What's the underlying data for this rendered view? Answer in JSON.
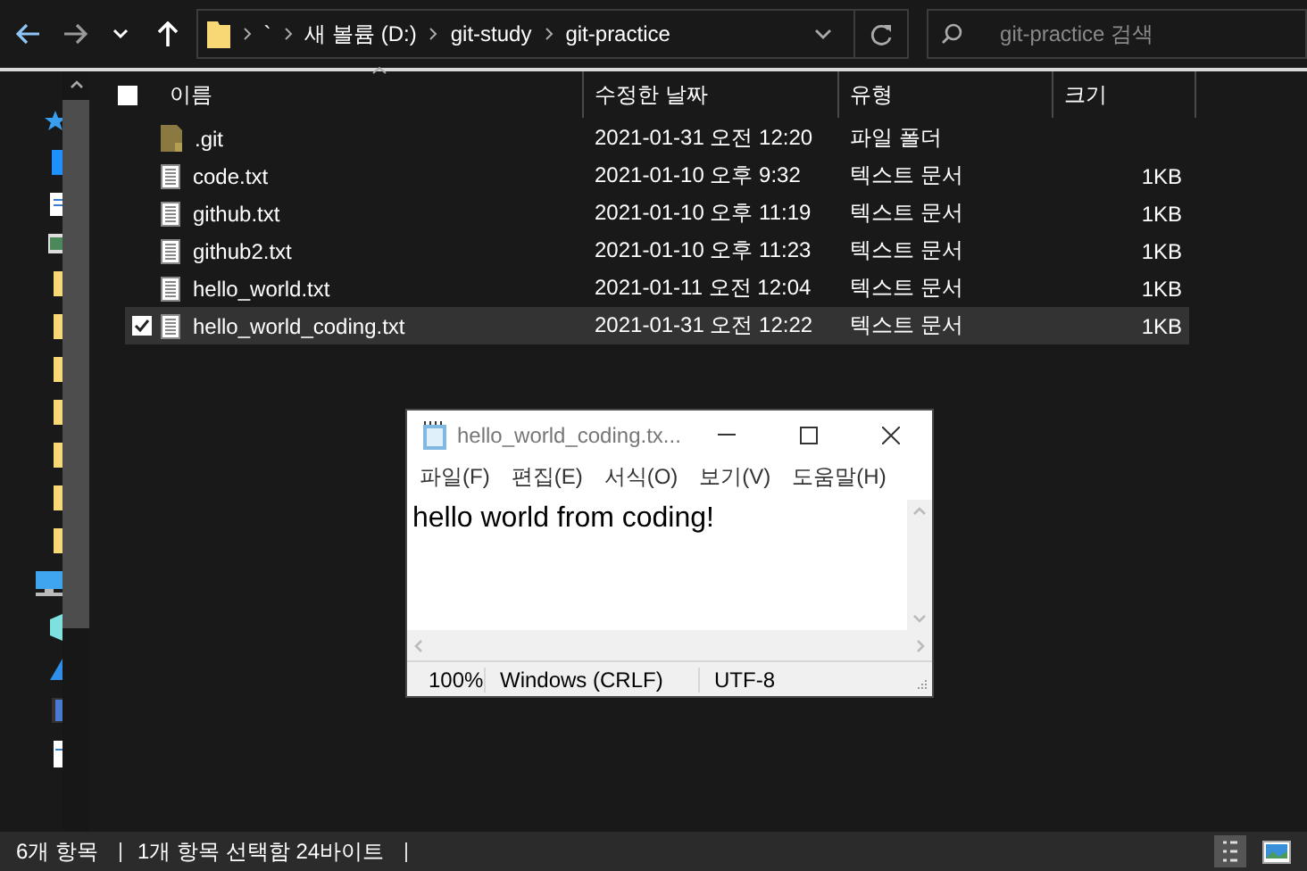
{
  "toolbar": {
    "path": [
      {
        "label": "`"
      },
      {
        "label": "새 볼륨 (D:)"
      },
      {
        "label": "git-study"
      },
      {
        "label": "git-practice"
      }
    ],
    "search": {
      "placeholder": "git-practice 검색"
    }
  },
  "select_all": {
    "checked": false
  },
  "columns": [
    {
      "label": "이름",
      "sorted": true
    },
    {
      "label": "수정한 날짜",
      "sorted": false
    },
    {
      "label": "유형",
      "sorted": false
    },
    {
      "label": "크기",
      "sorted": false
    }
  ],
  "files": [
    {
      "kind": "folder",
      "name": ".git",
      "date": "2021-01-31 오전 12:20",
      "type": "파일 폴더",
      "selected": false
    },
    {
      "kind": "text",
      "name": "code.txt",
      "date": "2021-01-10 오후 9:32",
      "type": "텍스트 문서",
      "size": "1KB",
      "selected": false
    },
    {
      "kind": "text",
      "name": "github.txt",
      "date": "2021-01-10 오후 11:19",
      "type": "텍스트 문서",
      "size": "1KB",
      "selected": false
    },
    {
      "kind": "text",
      "name": "github2.txt",
      "date": "2021-01-10 오후 11:23",
      "type": "텍스트 문서",
      "size": "1KB",
      "selected": false
    },
    {
      "kind": "text",
      "name": "hello_world.txt",
      "date": "2021-01-11 오전 12:04",
      "type": "텍스트 문서",
      "size": "1KB",
      "selected": false
    },
    {
      "kind": "text",
      "name": "hello_world_coding.txt",
      "date": "2021-01-31 오전 12:22",
      "type": "텍스트 문서",
      "size": "1KB",
      "selected": true
    }
  ],
  "notepad": {
    "title": "hello_world_coding.tx...",
    "menu": [
      {
        "label": "파일(F)"
      },
      {
        "label": "편집(E)"
      },
      {
        "label": "서식(O)"
      },
      {
        "label": "보기(V)"
      },
      {
        "label": "도움말(H)"
      }
    ],
    "text": "hello world from coding!",
    "status": [
      {
        "label": "100%"
      },
      {
        "label": "Windows (CRLF)"
      },
      {
        "label": "UTF-8"
      }
    ]
  },
  "status_bar": {
    "item_count": "6개 항목",
    "selection": "1개 항목 선택함 24바이트",
    "views": [
      {
        "kind": "details",
        "selected": true
      },
      {
        "kind": "large-icons",
        "selected": false
      }
    ]
  }
}
